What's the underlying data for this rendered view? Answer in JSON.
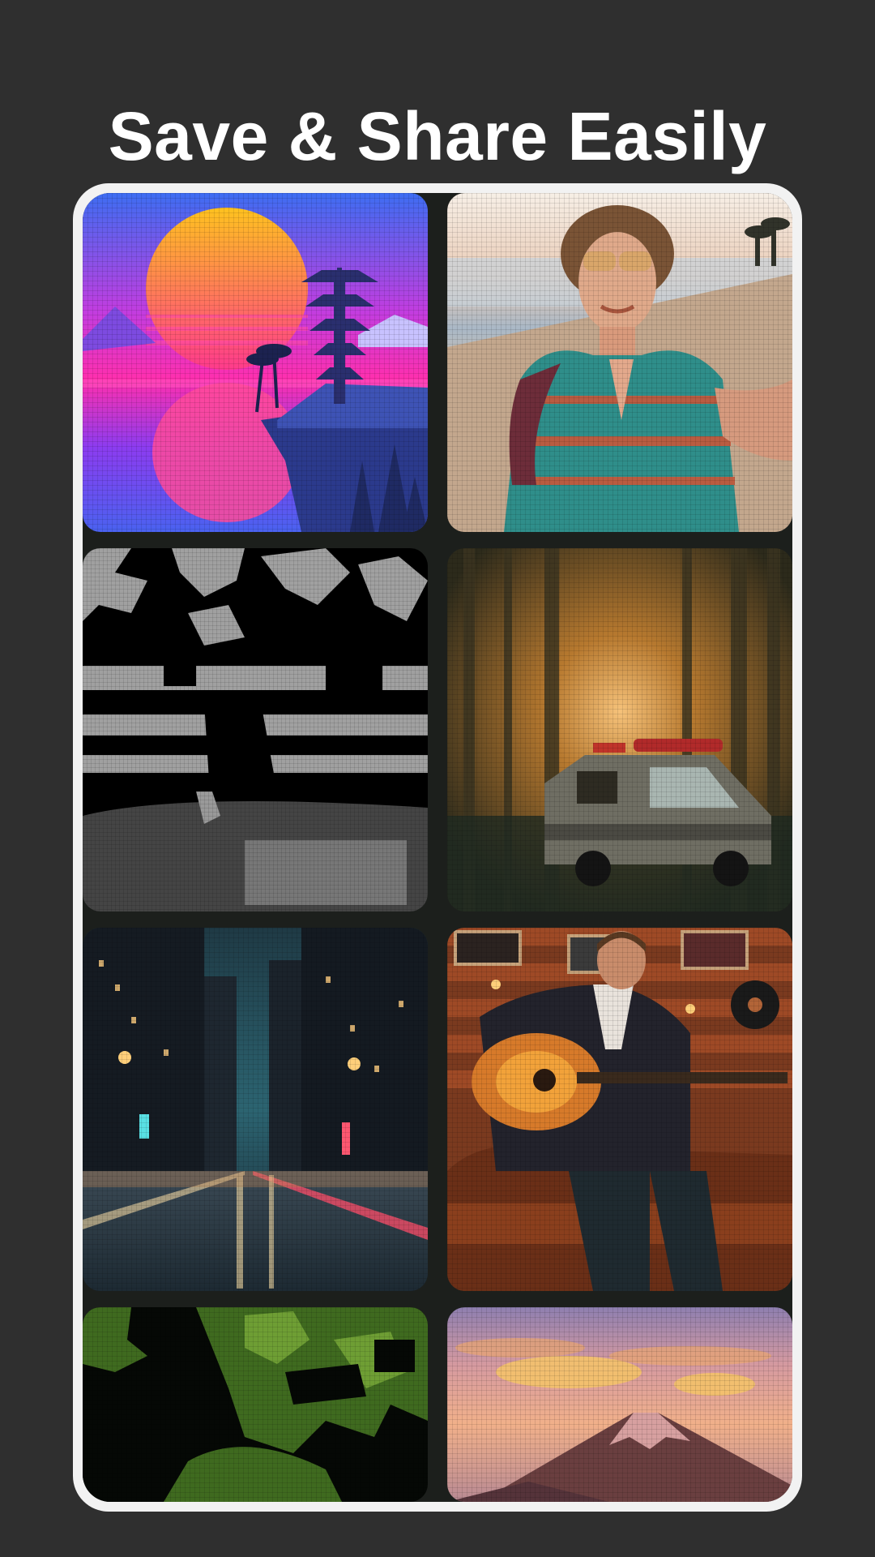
{
  "headline": "Save & Share Easily",
  "colors": {
    "background": "#2f2f2f",
    "frame": "#f2f2f2",
    "screen": "#1c1f1c",
    "headline_text": "#ffffff"
  },
  "gallery": {
    "items": [
      {
        "id": "synthwave-pagoda-sunset"
      },
      {
        "id": "beach-selfie-woman"
      },
      {
        "id": "monochrome-park-child"
      },
      {
        "id": "forest-van-sunset"
      },
      {
        "id": "rainy-city-street-night"
      },
      {
        "id": "guitarist-on-sofa"
      },
      {
        "id": "green-posterized-figure"
      },
      {
        "id": "mountain-pastel-sky"
      }
    ]
  }
}
